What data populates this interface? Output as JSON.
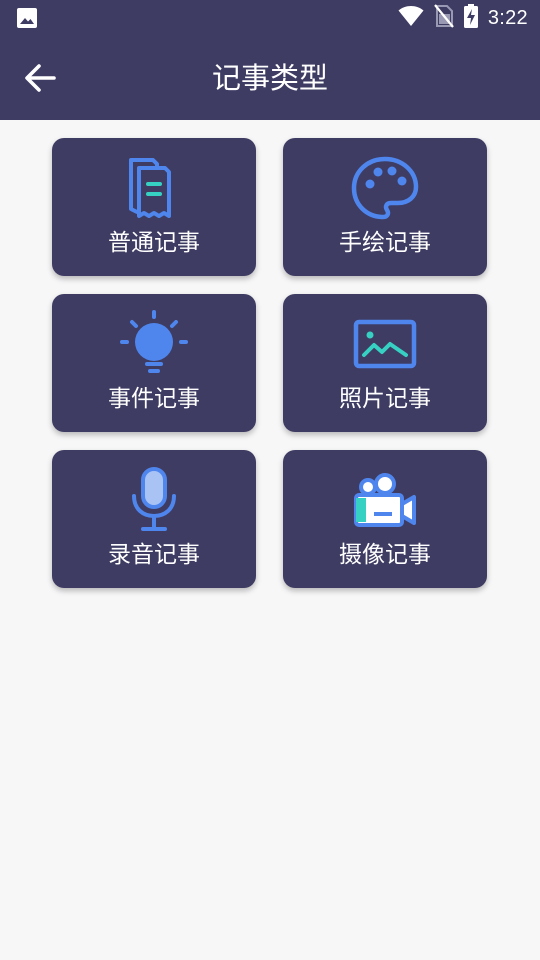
{
  "status": {
    "time": "3:22"
  },
  "header": {
    "title": "记事类型"
  },
  "cards": [
    {
      "label": "普通记事",
      "icon": "note-icon"
    },
    {
      "label": "手绘记事",
      "icon": "palette-icon"
    },
    {
      "label": "事件记事",
      "icon": "lightbulb-icon"
    },
    {
      "label": "照片记事",
      "icon": "photo-icon"
    },
    {
      "label": "录音记事",
      "icon": "microphone-icon"
    },
    {
      "label": "摄像记事",
      "icon": "video-camera-icon"
    }
  ],
  "colors": {
    "header_bg": "#3e3c63",
    "card_bg": "#3e3c63",
    "icon_blue": "#4f86ee",
    "icon_teal": "#37d1c4",
    "page_bg": "#f7f7f8"
  }
}
